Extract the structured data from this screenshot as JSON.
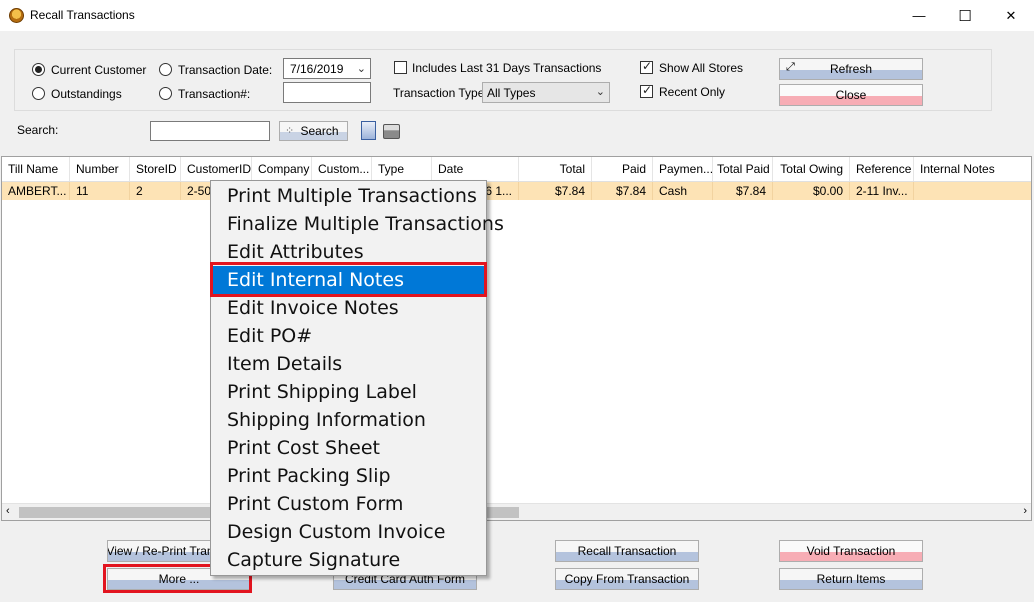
{
  "window": {
    "title": "Recall Transactions",
    "controls": {
      "minimize": "—",
      "maximize": "☐",
      "close": "✕"
    }
  },
  "filters": {
    "radio_current_customer": "Current Customer",
    "radio_outstandings": "Outstandings",
    "radio_transaction_date": "Transaction Date:",
    "radio_transaction_number": "Transaction#:",
    "date_value": "7/16/2019",
    "transaction_number_value": "",
    "includes_last_31_days": "Includes Last 31 Days Transactions",
    "transaction_type_label": "Transaction Type:",
    "transaction_type_value": "All Types",
    "show_all_stores": "Show All Stores",
    "recent_only": "Recent Only",
    "refresh_label": "Refresh",
    "close_label": "Close",
    "search_label": "Search:",
    "search_value": "",
    "search_button": "Search"
  },
  "table": {
    "columns": [
      "Till Name",
      "Number",
      "StoreID",
      "CustomerID",
      "Company",
      "Custom...",
      "Type",
      "Date",
      "Total",
      "Paid",
      "Paymen...",
      "Total Paid",
      "Total Owing",
      "Reference",
      "Internal Notes"
    ],
    "rows": [
      [
        "AMBERT...",
        "11",
        "2",
        "2-505",
        "",
        "",
        "",
        "6 1...",
        "$7.84",
        "$7.84",
        "Cash",
        "$7.84",
        "$0.00",
        "2-11 Inv...",
        ""
      ]
    ]
  },
  "context_menu": {
    "items": [
      "Print Multiple Transactions",
      "Finalize Multiple Transactions",
      "Edit Attributes",
      "Edit Internal Notes",
      "Edit Invoice Notes",
      "Edit PO#",
      "Item Details",
      "Print Shipping Label",
      "Shipping Information",
      "Print Cost Sheet",
      "Print Packing Slip",
      "Print Custom Form",
      "Design Custom Invoice",
      "Capture Signature"
    ],
    "selected": "Edit Internal Notes"
  },
  "bottom_buttons": {
    "view_reprint": "View / Re-Print Transaction",
    "more": "More ...",
    "credit_card_auth": "Credit Card Auth Form",
    "recall_transaction": "Recall Transaction",
    "copy_from_transaction": "Copy From Transaction",
    "void_transaction": "Void Transaction",
    "return_items": "Return Items"
  },
  "colors": {
    "selection_blue": "#0078d7",
    "highlight_red": "#e2141f",
    "row_highlight": "#fde3b5"
  }
}
